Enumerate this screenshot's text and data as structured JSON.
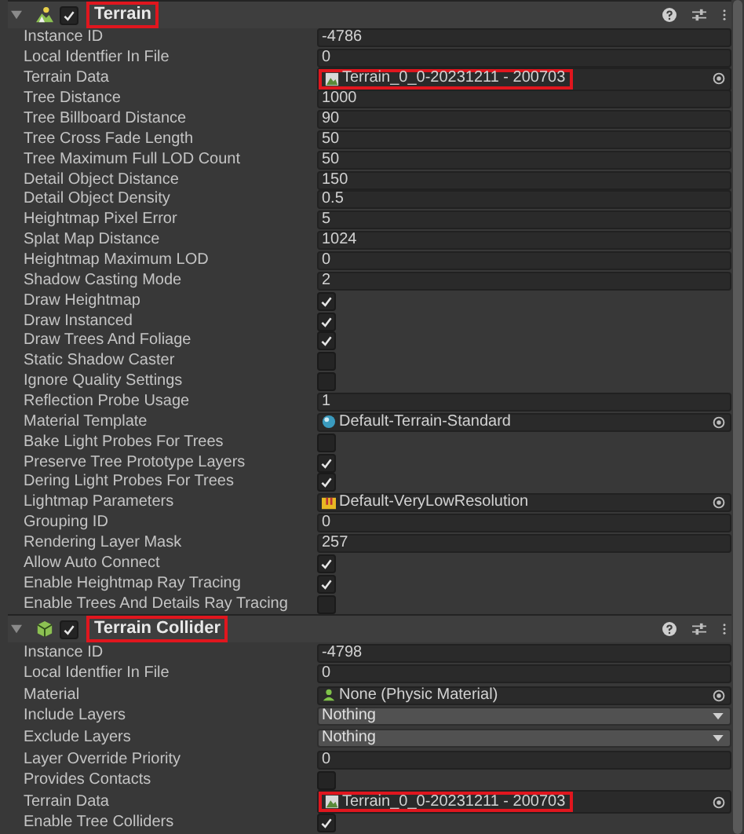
{
  "components": [
    {
      "title": "Terrain",
      "enabled": true,
      "expanded": true,
      "rows": [
        {
          "label": "Instance ID",
          "kind": "text",
          "value": "-4786"
        },
        {
          "label": "Local Identfier In File",
          "kind": "text",
          "value": "0"
        },
        {
          "label": "Terrain Data",
          "kind": "object",
          "value": "Terrain_0_0-20231211 - 200703"
        },
        {
          "label": "Tree Distance",
          "kind": "text",
          "value": "1000"
        },
        {
          "label": "Tree Billboard Distance",
          "kind": "text",
          "value": "90"
        },
        {
          "label": "Tree Cross Fade Length",
          "kind": "text",
          "value": "50"
        },
        {
          "label": "Tree Maximum Full LOD Count",
          "kind": "text",
          "value": "50"
        },
        {
          "label": "Detail Object Distance",
          "kind": "text",
          "value": "150"
        },
        {
          "label": "Detail Object Density",
          "kind": "text",
          "value": "0.5"
        },
        {
          "label": "Heightmap Pixel Error",
          "kind": "text",
          "value": "5"
        },
        {
          "label": "Splat Map Distance",
          "kind": "text",
          "value": "1024"
        },
        {
          "label": "Heightmap Maximum LOD",
          "kind": "text",
          "value": "0"
        },
        {
          "label": "Shadow Casting Mode",
          "kind": "text",
          "value": "2"
        },
        {
          "label": "Draw Heightmap",
          "kind": "check",
          "checked": true
        },
        {
          "label": "Draw Instanced",
          "kind": "check",
          "checked": true
        },
        {
          "label": "Draw Trees And Foliage",
          "kind": "check",
          "checked": true
        },
        {
          "label": "Static Shadow Caster",
          "kind": "check",
          "checked": false
        },
        {
          "label": "Ignore Quality Settings",
          "kind": "check",
          "checked": false
        },
        {
          "label": "Reflection Probe Usage",
          "kind": "text",
          "value": "1"
        },
        {
          "label": "Material Template",
          "kind": "object",
          "value": "Default-Terrain-Standard"
        },
        {
          "label": "Bake Light Probes For Trees",
          "kind": "check",
          "checked": false
        },
        {
          "label": "Preserve Tree Prototype Layers",
          "kind": "check",
          "checked": true
        },
        {
          "label": "Dering Light Probes For Trees",
          "kind": "check",
          "checked": true
        },
        {
          "label": "Lightmap Parameters",
          "kind": "object",
          "value": "Default-VeryLowResolution"
        },
        {
          "label": "Grouping ID",
          "kind": "text",
          "value": "0"
        },
        {
          "label": "Rendering Layer Mask",
          "kind": "text",
          "value": "257"
        },
        {
          "label": "Allow Auto Connect",
          "kind": "check",
          "checked": true
        },
        {
          "label": "Enable Heightmap Ray Tracing",
          "kind": "check",
          "checked": true
        },
        {
          "label": "Enable Trees And Details Ray Tracing",
          "kind": "check",
          "checked": false
        }
      ]
    },
    {
      "title": "Terrain Collider",
      "enabled": true,
      "expanded": true,
      "rows": [
        {
          "label": "Instance ID",
          "kind": "text",
          "value": "-4798"
        },
        {
          "label": "Local Identfier In File",
          "kind": "text",
          "value": "0"
        },
        {
          "label": "Material",
          "kind": "object",
          "value": "None (Physic Material)"
        },
        {
          "label": "Include Layers",
          "kind": "dropdown",
          "value": "Nothing"
        },
        {
          "label": "Exclude Layers",
          "kind": "dropdown",
          "value": "Nothing"
        },
        {
          "label": "Layer Override Priority",
          "kind": "text",
          "value": "0"
        },
        {
          "label": "Provides Contacts",
          "kind": "check",
          "checked": false
        },
        {
          "label": "Terrain Data",
          "kind": "object",
          "value": "Terrain_0_0-20231211 - 200703"
        },
        {
          "label": "Enable Tree Colliders",
          "kind": "check",
          "checked": true
        }
      ]
    }
  ]
}
